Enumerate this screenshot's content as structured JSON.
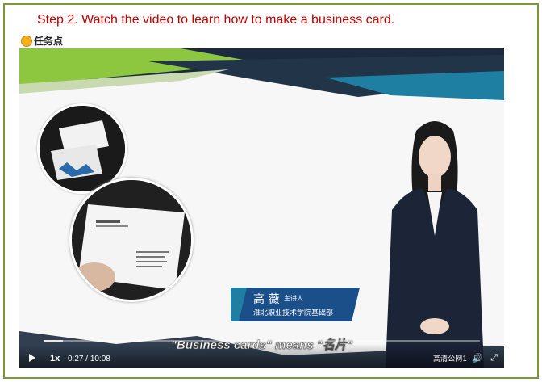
{
  "header": {
    "step_title": "Step 2. Watch the video to learn how to make a business card.",
    "task_label": "任务点"
  },
  "video": {
    "nameplate": {
      "name": "高 薇",
      "role": "主讲人",
      "org": "淮北职业技术学院基础部"
    },
    "subtitle": "\"Business cards\" means \"名片\"",
    "controls": {
      "speed": "1x",
      "current_time": "0:27",
      "total_time": "10:08",
      "time_separator": "/",
      "quality": "高清",
      "line": "公网1"
    },
    "progress_fraction": 0.044
  },
  "colors": {
    "accent_green": "#8dc63f",
    "navy": "#1b2a3e",
    "teal": "#1e7fa3",
    "title_red": "#c00000"
  },
  "icons": {
    "task": "task-point-icon",
    "play": "play-icon",
    "volume": "volume-icon",
    "fullscreen": "fullscreen-icon"
  }
}
